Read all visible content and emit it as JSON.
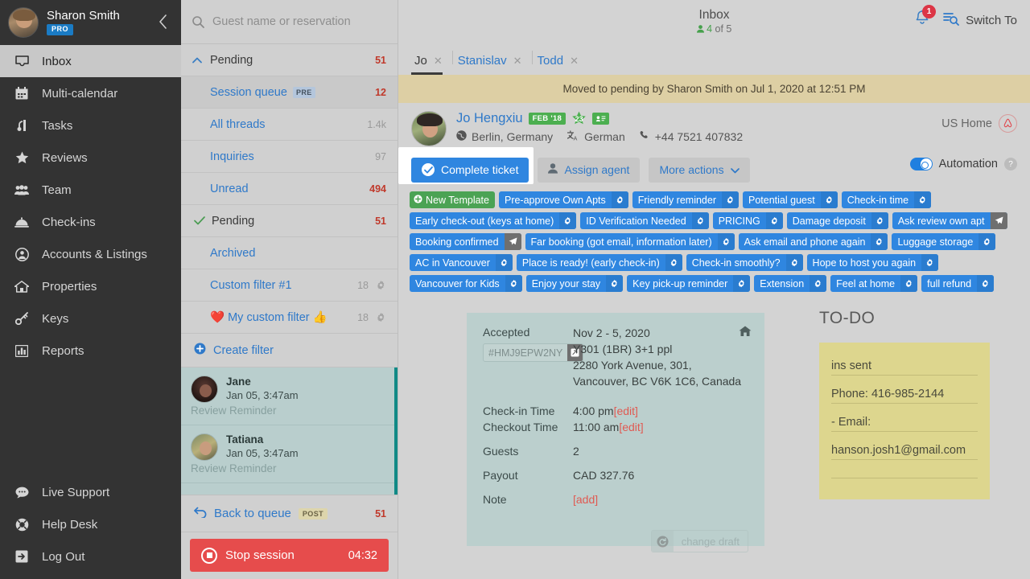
{
  "sidebar": {
    "user": {
      "name": "Sharon Smith",
      "plan_badge": "PRO"
    },
    "items": [
      {
        "label": "Inbox",
        "icon": "inbox-icon",
        "active": true
      },
      {
        "label": "Multi-calendar",
        "icon": "calendar-icon",
        "active": false
      },
      {
        "label": "Tasks",
        "icon": "tasks-icon",
        "active": false
      },
      {
        "label": "Reviews",
        "icon": "star-icon",
        "active": false
      },
      {
        "label": "Team",
        "icon": "team-icon",
        "active": false
      },
      {
        "label": "Check-ins",
        "icon": "bell-desk-icon",
        "active": false
      },
      {
        "label": "Accounts & Listings",
        "icon": "user-circle-icon",
        "active": false
      },
      {
        "label": "Properties",
        "icon": "house-icon",
        "active": false
      },
      {
        "label": "Keys",
        "icon": "key-icon",
        "active": false
      },
      {
        "label": "Reports",
        "icon": "chart-bar-icon",
        "active": false
      }
    ],
    "bottom_items": [
      {
        "label": "Live Support",
        "icon": "chat-bubble-icon"
      },
      {
        "label": "Help Desk",
        "icon": "lifebuoy-icon"
      },
      {
        "label": "Log Out",
        "icon": "logout-icon"
      }
    ]
  },
  "filters": {
    "search_placeholder": "Guest name or reservation",
    "rows": [
      {
        "label": "Pending",
        "count": "51",
        "count_red": true,
        "kind": "group-open"
      },
      {
        "label": "Session queue",
        "badge": "PRE",
        "count": "12",
        "count_red": true,
        "kind": "sub-selected"
      },
      {
        "label": "All threads",
        "count": "1.4k",
        "count_red": false,
        "kind": "sub"
      },
      {
        "label": "Inquiries",
        "count": "97",
        "count_red": false,
        "kind": "sub"
      },
      {
        "label": "Unread",
        "count": "494",
        "count_red": true,
        "kind": "sub"
      },
      {
        "label": "Pending",
        "count": "51",
        "count_red": true,
        "kind": "group-check"
      },
      {
        "label": "Archived",
        "count": "",
        "count_red": false,
        "kind": "sub"
      },
      {
        "label": "Custom filter #1",
        "count": "18",
        "count_red": false,
        "kind": "sub-gear"
      },
      {
        "label": "❤️ My custom filter 👍",
        "count": "18",
        "count_red": false,
        "kind": "sub-gear"
      }
    ],
    "create_filter_label": "Create filter"
  },
  "threads": [
    {
      "name": "Jane",
      "date": "Jan 05, 3:47am",
      "subject": "Review Reminder"
    },
    {
      "name": "Tatiana",
      "date": "Jan 05, 3:47am",
      "subject": "Review Reminder"
    }
  ],
  "queue": {
    "back_label": "Back to queue",
    "back_badge": "POST",
    "back_count": "51",
    "stop_label": "Stop session",
    "stop_timer": "04:32"
  },
  "topbar": {
    "title": "Inbox",
    "sub_count": "4",
    "sub_rest": "of 5",
    "notification_count": "1",
    "switch_to_label": "Switch To"
  },
  "tabs": [
    {
      "label": "Jo",
      "active": true
    },
    {
      "label": "Stanislav",
      "active": false
    },
    {
      "label": "Todd",
      "active": false
    }
  ],
  "moved_banner": "Moved to pending by Sharon Smith on Jul 1, 2020 at 12:51 PM",
  "guest": {
    "name": "Jo Hengxiu",
    "badge_month": "FEB '18",
    "badge_star_count": "23",
    "location": "Berlin, Germany",
    "language": "German",
    "phone": "+44 7521 407832",
    "channel": "US Home"
  },
  "actions": {
    "complete_label": "Complete ticket",
    "assign_label": "Assign agent",
    "more_label": "More actions",
    "automation_label": "Automation",
    "help_glyph": "?"
  },
  "templates": [
    {
      "label": "New Template",
      "style": "green",
      "gear": false
    },
    {
      "label": "Pre-approve Own Apts",
      "style": "blue",
      "gear": "gear"
    },
    {
      "label": "Friendly reminder",
      "style": "blue",
      "gear": "gear"
    },
    {
      "label": "Potential guest",
      "style": "blue",
      "gear": "gear"
    },
    {
      "label": "Check-in time",
      "style": "blue",
      "gear": "gear"
    },
    {
      "label": "Early check-out (keys at home)",
      "style": "blue",
      "gear": "gear"
    },
    {
      "label": "ID Verification Needed",
      "style": "blue",
      "gear": "gear"
    },
    {
      "label": "PRICING",
      "style": "blue",
      "gear": "gear"
    },
    {
      "label": "Damage deposit",
      "style": "blue",
      "gear": "gear"
    },
    {
      "label": "Ask review own apt",
      "style": "blue",
      "gear": "plane"
    },
    {
      "label": "Booking confirmed",
      "style": "blue",
      "gear": "plane"
    },
    {
      "label": "Far booking (got email, information later)",
      "style": "blue",
      "gear": "gear"
    },
    {
      "label": "Ask email and phone again",
      "style": "blue",
      "gear": "gear"
    },
    {
      "label": "Luggage storage",
      "style": "blue",
      "gear": "gear"
    },
    {
      "label": "AC in Vancouver",
      "style": "blue",
      "gear": "gear"
    },
    {
      "label": "Place is ready! (early check-in)",
      "style": "blue",
      "gear": "gear"
    },
    {
      "label": "Check-in smoothly?",
      "style": "blue",
      "gear": "gear"
    },
    {
      "label": "Hope to host you again",
      "style": "blue",
      "gear": "gear"
    },
    {
      "label": "Vancouver for Kids",
      "style": "blue",
      "gear": "gear"
    },
    {
      "label": "Enjoy your stay",
      "style": "blue",
      "gear": "gear"
    },
    {
      "label": "Key pick-up reminder",
      "style": "blue",
      "gear": "gear"
    },
    {
      "label": "Extension",
      "style": "blue",
      "gear": "gear"
    },
    {
      "label": "Feel at home",
      "style": "blue",
      "gear": "gear"
    },
    {
      "label": "full refund",
      "style": "blue",
      "gear": "gear"
    }
  ],
  "reservation": {
    "status": "Accepted",
    "confirmation_code": "#HMJ9EPW2NY",
    "dates": "Nov 2 - 5, 2020",
    "unit": "Y301 (1BR) 3+1 ppl",
    "address_1": "2280 York Avenue, 301,",
    "address_2": "Vancouver, BC V6K 1C6, Canada",
    "checkin_label": "Check-in Time",
    "checkin_value": "4:00 pm",
    "checkin_edit": "[edit]",
    "checkout_label": "Checkout Time",
    "checkout_value": "11:00 am",
    "checkout_edit": "[edit]",
    "guests_label": "Guests",
    "guests_value": "2",
    "payout_label": "Payout",
    "payout_value": "CAD 327.76",
    "note_label": "Note",
    "note_value": "[add]",
    "change_draft_label": "change draft"
  },
  "todo": {
    "title": "TO-DO",
    "lines": [
      "ins sent",
      "Phone: 416-985-2144",
      "- Email:",
      "hanson.josh1@gmail.com"
    ]
  },
  "colors": {
    "accent_blue": "#2f86e0",
    "link_blue": "#2f79c9",
    "green": "#4ba354",
    "red": "#e64c4c",
    "banner_tan": "#ddcfa4",
    "note_yellow": "#ddd68e",
    "teal": "#108a86",
    "sidebar_dark": "#333333"
  }
}
